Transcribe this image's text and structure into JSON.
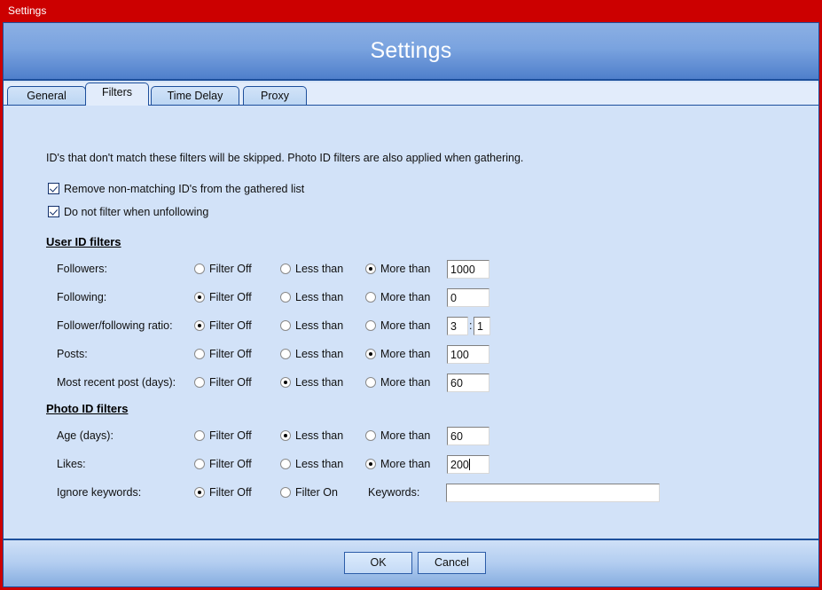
{
  "titlebar": {
    "text": "Settings"
  },
  "header": {
    "title": "Settings"
  },
  "tabs": [
    {
      "label": "General"
    },
    {
      "label": "Filters"
    },
    {
      "label": "Time Delay"
    },
    {
      "label": "Proxy"
    }
  ],
  "content": {
    "intro": "ID's that don't match these filters will be skipped. Photo ID filters are also applied when gathering.",
    "checkboxes": [
      {
        "label": "Remove non-matching ID's from the gathered list",
        "checked": true
      },
      {
        "label": "Do not filter when unfollowing",
        "checked": true
      }
    ],
    "user_section_title": "User ID filters",
    "photo_section_title": "Photo ID filters",
    "option_labels": {
      "filter_off": "Filter Off",
      "less_than": "Less than",
      "more_than": "More than",
      "filter_on": "Filter On"
    },
    "user_rows": [
      {
        "label": "Followers:",
        "selected": "more_than",
        "value": "1000"
      },
      {
        "label": "Following:",
        "selected": "filter_off",
        "value": "0"
      },
      {
        "label": "Follower/following ratio:",
        "selected": "filter_off",
        "value": "3",
        "value2": "1",
        "separator": ":"
      },
      {
        "label": "Posts:",
        "selected": "more_than",
        "value": "100"
      },
      {
        "label": "Most recent post (days):",
        "selected": "less_than",
        "value": "60"
      }
    ],
    "photo_rows": [
      {
        "label": "Age (days):",
        "selected": "less_than",
        "value": "60"
      },
      {
        "label": "Likes:",
        "selected": "more_than",
        "value": "200",
        "focused": true
      }
    ],
    "keywords_row": {
      "label": "Ignore keywords:",
      "selected": "filter_off",
      "keywords_label": "Keywords:",
      "keywords_value": "",
      "keywords_placeholder": ""
    }
  },
  "footer": {
    "ok_label": "OK",
    "cancel_label": "Cancel"
  },
  "colors": {
    "frame_red": "#cc0000",
    "header_blue": "#7aa3df",
    "border_blue": "#1d4f9c",
    "content_bg": "#d2e2f8",
    "tabstrip_bg": "#e2ecfb"
  }
}
